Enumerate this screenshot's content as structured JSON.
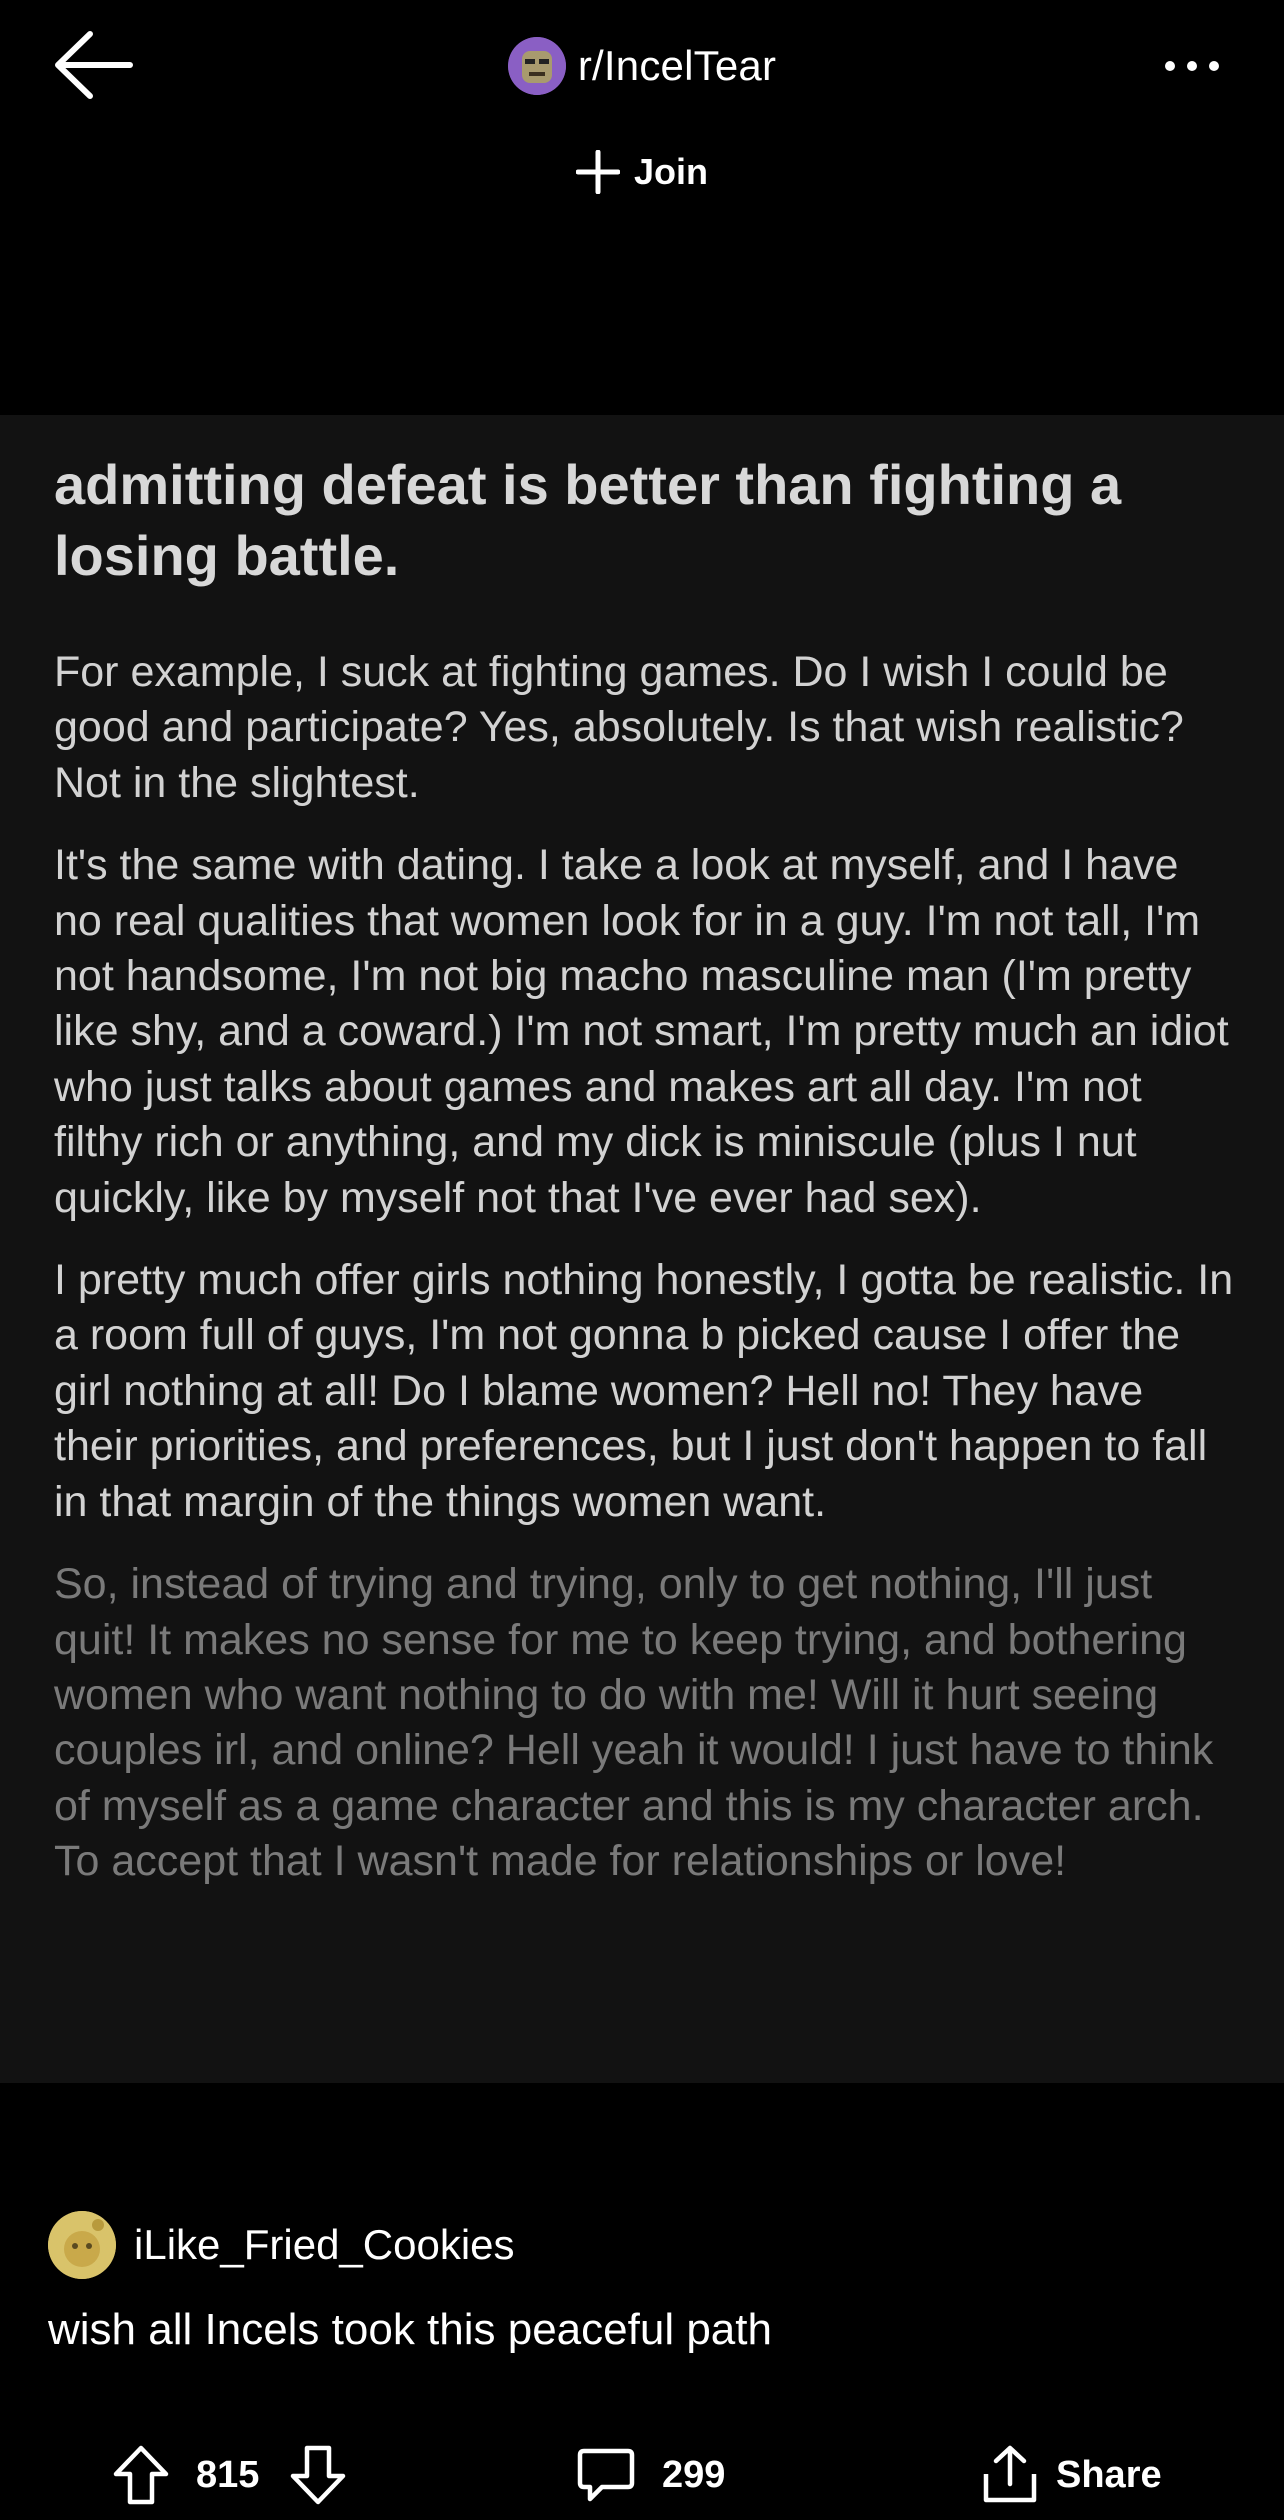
{
  "header": {
    "subreddit": "r/IncelTear",
    "join_label": "Join",
    "back_icon": "arrow-left-icon",
    "more_icon": "more-horizontal-icon"
  },
  "post": {
    "title": "admitting defeat is better than fighting a losing battle.",
    "paragraphs": [
      "For example, I suck at fighting games. Do I wish I could be good and participate? Yes, absolutely. Is that wish realistic? Not in the slightest.",
      "It's the same with dating. I take a look at myself, and I have no real qualities that women look for in a guy. I'm not tall, I'm not handsome, I'm not big macho masculine man (I'm pretty like shy, and a coward.) I'm not smart, I'm pretty much an idiot who just talks about games and makes art all day. I'm not filthy rich or anything, and my dick is miniscule (plus I nut quickly, like by myself not that I've ever had sex).",
      "I pretty much offer girls nothing honestly, I gotta be realistic. In a room full of guys, I'm not gonna b picked cause I offer the girl nothing at all! Do I blame women? Hell no! They have their priorities, and preferences, but I just don't happen to fall in that margin of the things women want.",
      "So, instead of trying and trying, only to get nothing, I'll just quit! It makes no sense for me to keep trying, and bothering women who want nothing to do with me! Will it hurt seeing couples irl, and online? Hell yeah it would! I just have to think of myself as a game character and this is my character arch. To accept that I wasn't made for relationships or love!"
    ]
  },
  "comment": {
    "username": "iLike_Fried_Cookies",
    "text": "wish all Incels took this peaceful path"
  },
  "actions": {
    "upvotes": "815",
    "comments": "299",
    "share_label": "Share"
  },
  "colors": {
    "background": "#000000",
    "card": "#121212",
    "title_text": "#d8d8d8",
    "body_text": "#d2d2d2",
    "faded_text": "#7a7a7a",
    "sub_avatar": "#8a5fc4",
    "user_avatar": "#d9c36a"
  }
}
